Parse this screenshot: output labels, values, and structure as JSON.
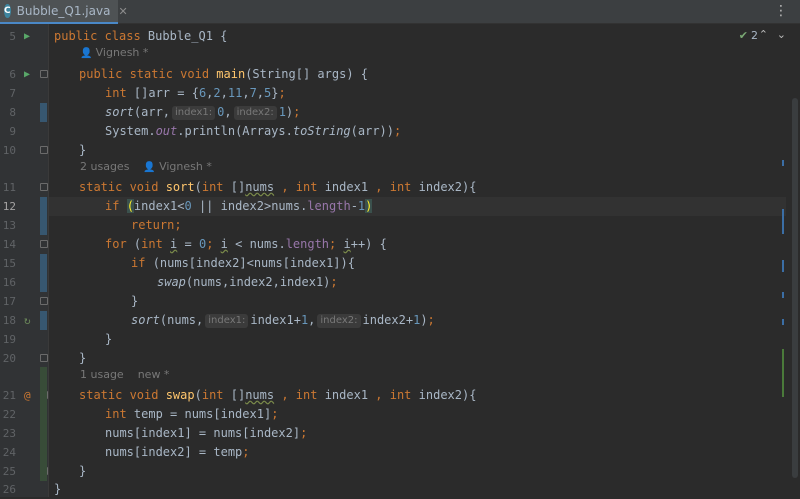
{
  "tab": {
    "icon_letter": "C",
    "filename": "Bubble_Q1.java",
    "close": "✕"
  },
  "toolbar": {
    "menu": "⋮",
    "inspections": "✔",
    "inspection_count": "2",
    "nav_up": "⌃",
    "nav_down": "⌄"
  },
  "gutter": {
    "line_numbers": [
      "5",
      "6",
      "7",
      "8",
      "9",
      "10",
      "11",
      "12",
      "13",
      "14",
      "15",
      "16",
      "17",
      "18",
      "19",
      "20",
      "21",
      "22",
      "23",
      "24",
      "25",
      "26"
    ],
    "current_line": "12"
  },
  "editor": {
    "meta": {
      "main_author": "Vignesh *",
      "sort_usages": "2 usages",
      "sort_author": "Vignesh *",
      "swap_usages": "1 usage",
      "swap_author": "new *"
    },
    "hints": {
      "l8_index1": "index1:",
      "l8_index2": "index2:",
      "l18_index1": "index1:",
      "l18_index2": "index2:"
    }
  },
  "colors": {
    "background": "#2b2b2b",
    "keyword": "#cc7832",
    "number": "#6897bb",
    "method": "#ffc66d",
    "field": "#9876aa",
    "text": "#a9b7c6"
  }
}
